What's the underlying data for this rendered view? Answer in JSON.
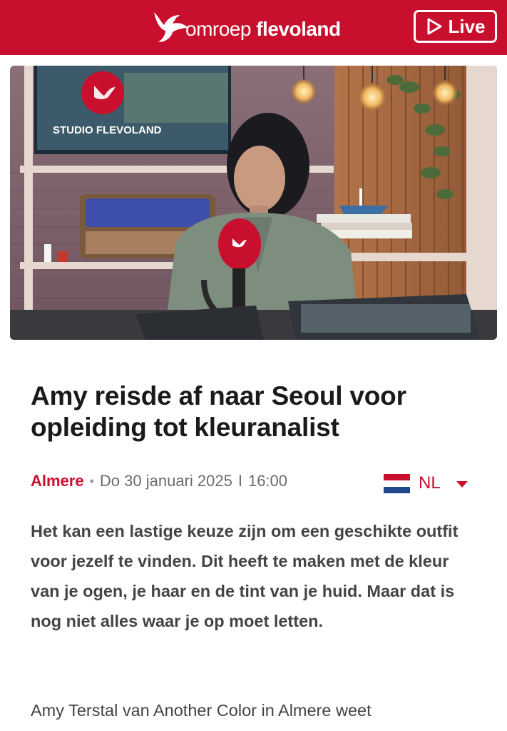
{
  "header": {
    "brand_light": "omroep ",
    "brand_bold": "flevoland",
    "live_label": "Live",
    "colors": {
      "brand": "#c8102e",
      "text": "#ffffff"
    }
  },
  "hero": {
    "image_text": "STUDIO FLEVOLAND"
  },
  "article": {
    "title": "Amy reisde af naar Seoul voor opleiding tot kleuranalist",
    "location": "Almere",
    "date": "Do 30 januari 2025",
    "separator": "I",
    "time": "16:00",
    "intro": "Het kan een lastige keuze zijn om een geschikte outfit voor jezelf te vinden. Dit heeft te maken met de kleur van je ogen, je haar en de tint van je huid. Maar dat is nog niet alles waar je op moet letten.",
    "body_first_line": "Amy Terstal van Another Color in Almere weet"
  },
  "language": {
    "selected": "NL",
    "flag_icon": "netherlands-flag-icon",
    "flag_colors": [
      "#c8102e",
      "#ffffff",
      "#21468b"
    ]
  }
}
